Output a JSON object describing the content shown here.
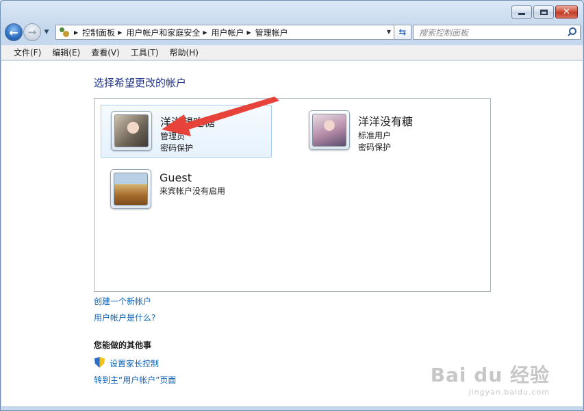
{
  "window": {
    "caption": {
      "minimize": "–",
      "maximize": "□",
      "close": "✕"
    }
  },
  "navbar": {
    "breadcrumbs": [
      "控制面板",
      "用户帐户和家庭安全",
      "用户帐户",
      "管理帐户"
    ],
    "search_placeholder": "搜索控制面板"
  },
  "menu": [
    "文件(F)",
    "编辑(E)",
    "查看(V)",
    "工具(T)",
    "帮助(H)"
  ],
  "main": {
    "heading": "选择希望更改的帐户",
    "accounts": [
      {
        "name": "洋洋想吃糖",
        "type": "管理员",
        "status": "密码保护",
        "selected": true
      },
      {
        "name": "洋洋没有糖",
        "type": "标准用户",
        "status": "密码保护",
        "selected": false
      },
      {
        "name": "Guest",
        "type": "来宾帐户没有启用",
        "status": "",
        "selected": false
      }
    ],
    "links": {
      "create": "创建一个新帐户",
      "what_is": "用户帐户是什么?"
    },
    "other": {
      "title": "您能做的其他事",
      "parental": "设置家长控制",
      "goto_main": "转到主“用户帐户”页面"
    }
  },
  "watermark": {
    "main": "Bai du 经验",
    "sub": "jingyan.baidu.com"
  },
  "colors": {
    "heading": "#1e3287",
    "link": "#0a62b8",
    "arrow": "#e8433a"
  }
}
